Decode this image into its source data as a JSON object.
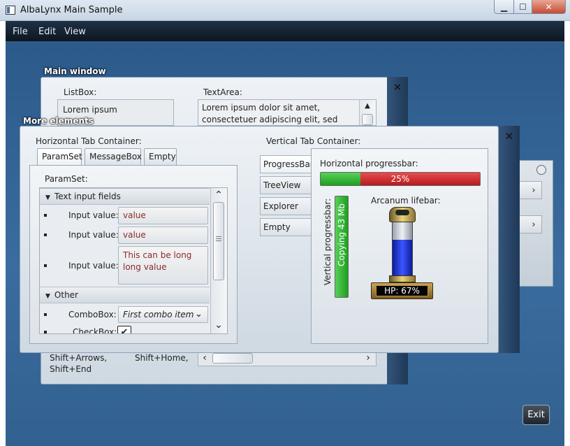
{
  "window": {
    "title": "AlbaLynx Main Sample"
  },
  "menubar": {
    "items": [
      "File",
      "Edit",
      "View"
    ]
  },
  "main_window": {
    "title": "Main window",
    "listbox_label": "ListBox:",
    "listbox_item": "Lorem ipsum",
    "textarea_label": "TextArea:",
    "textarea_text": "Lorem ipsum dolor sit amet, consectetuer adipiscing elit, sed diam",
    "shortcut_left_1": "Shift+Arrows,",
    "shortcut_left_2": "Shift+End",
    "shortcut_right": "Shift+Home,"
  },
  "more_elements": {
    "title": "More elements",
    "htab_label": "Horizontal Tab Container:",
    "htabs": [
      "ParamSet",
      "MessageBox",
      "Empty"
    ],
    "paramset_label": "ParamSet:",
    "section_text": "Text input fields",
    "section_other": "Other",
    "input_label": "Input value:",
    "input_value_1": "value",
    "input_value_2": "value",
    "input_value_3": "This can be long long value",
    "combo_label": "ComboBox:",
    "combo_value": "First combo item",
    "checkbox_label": "CheckBox:",
    "vtab_label": "Vertical Tab Container:",
    "vtabs": [
      "ProgressBar",
      "TreeView",
      "Explorer",
      "Empty"
    ],
    "hprogress_label": "Horizontal progressbar:",
    "hprogress_text": "25%",
    "hprogress_value": 0.25,
    "vprogress_label": "Vertical progressbar:",
    "vprogress_text": "Copying 43 Mb",
    "lifebar_label": "Arcanum lifebar:",
    "lifebar_text": "HP: 67%",
    "lifebar_value": 0.67
  },
  "exit_button": "Exit",
  "colors": {
    "desktop": "#33608f",
    "progress_green": "#2db52d",
    "progress_red": "#c9262a",
    "lifebar_blue": "#1b34d8"
  }
}
